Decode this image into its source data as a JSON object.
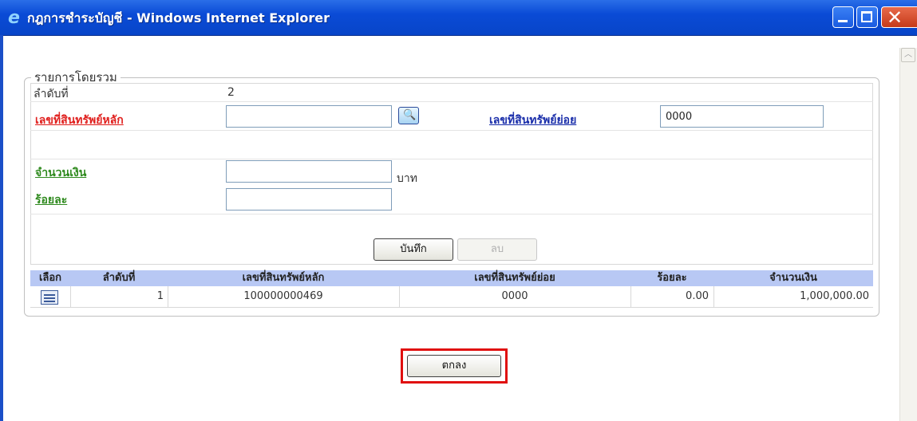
{
  "window": {
    "title": "กฎการชำระบัญชี - Windows Internet Explorer",
    "ie_icon": "e"
  },
  "form": {
    "legend": "รายการโดยรวม",
    "sequence_label": "ลำดับที่",
    "sequence_value": "2",
    "main_asset_label": "เลขที่สินทรัพย์หลัก",
    "main_asset_value": "",
    "sub_asset_label": "เลขที่สินทรัพย์ย่อย",
    "sub_asset_value": "0000",
    "amount_label": "จำนวนเงิน",
    "amount_value": "",
    "amount_unit": "บาท",
    "percent_label": "ร้อยละ",
    "percent_value": "",
    "save_label": "บันทึก",
    "delete_label": "ลบ"
  },
  "table": {
    "columns": [
      "เลือก",
      "ลำดับที่",
      "เลขที่สินทรัพย์หลัก",
      "เลขที่สินทรัพย์ย่อย",
      "ร้อยละ",
      "จำนวนเงิน"
    ],
    "rows": [
      {
        "seq": "1",
        "main_asset": "100000000469",
        "sub_asset": "0000",
        "percent": "0.00",
        "amount": "1,000,000.00"
      }
    ]
  },
  "footer": {
    "ok_label": "ตกลง"
  },
  "colors": {
    "title_bar": "#0a4bd6",
    "table_header": "#b8c8f4",
    "highlight": "#e01010"
  }
}
